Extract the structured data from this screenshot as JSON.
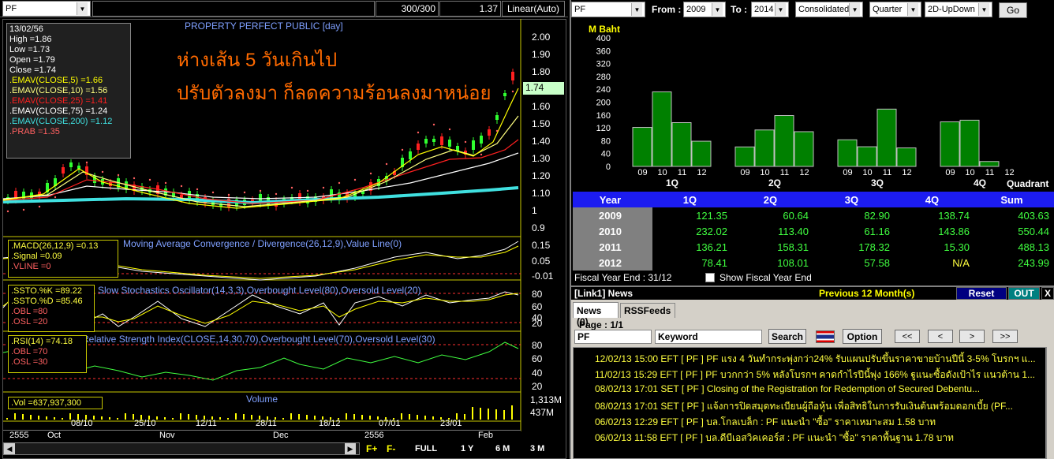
{
  "left": {
    "symbol": "PF",
    "range": "300/300",
    "last_value": "1.37",
    "scale": "Linear(Auto)",
    "main_title": "PROPERTY PERFECT PUBLIC [day]",
    "annotation_line1": "ห่างเส้น 5 วันเกินไป",
    "annotation_line2": "ปรับตัวลงมา ก็ลดความร้อนลงมาหน่อย",
    "price_tag": "1.74",
    "info": [
      "13/02/56",
      "High =1.86",
      "Low =1.73",
      "Open =1.79",
      "Close =1.74"
    ],
    "emas": [
      {
        "text": ".EMAV(CLOSE,5)  =1.66",
        "color": "#ffff00"
      },
      {
        "text": ".EMAV(CLOSE,10)  =1.56",
        "color": "#ffff80"
      },
      {
        "text": ".EMAV(CLOSE,25)  =1.41",
        "color": "#ff2020"
      },
      {
        "text": ".EMAV(CLOSE,75)  =1.24",
        "color": "#ffffff"
      },
      {
        "text": ".EMAV(CLOSE,200) =1.12",
        "color": "#40e0e0"
      },
      {
        "text": ".PRAB  =1.35",
        "color": "#ff6060"
      }
    ],
    "y_axis": [
      "2.00",
      "1.90",
      "1.80",
      "1.70",
      "1.60",
      "1.50",
      "1.40",
      "1.30",
      "1.20",
      "1.10",
      "1",
      "0.9"
    ],
    "macd": {
      "title": "Moving Average Convergence / Divergence(26,12,9),Value Line(0)",
      "lines": [
        ".MACD(26,12,9)  =0.13",
        ".Signal  =0.09",
        ".VLINE  =0"
      ],
      "axis": [
        "0.15",
        "0.05",
        "-0.01"
      ]
    },
    "stoch": {
      "title": "Slow Stochastics Oscillator(14,3,3),Overbought Level(80),Oversold Level(20)",
      "lines": [
        ".SSTO.%K  =89.22",
        ".SSTO.%D  =85.46",
        ".OBL  =80",
        ".OSL  =20"
      ],
      "axis": [
        "80",
        "60",
        "40",
        "20"
      ]
    },
    "rsi": {
      "title": "Relative Strength Index(CLOSE,14,30,70),Overbought Level(70),Oversold Level(30)",
      "lines": [
        ".RSI(14)  =74.18",
        ".OBL  =70",
        ".OSL  =30"
      ],
      "axis": [
        "80",
        "60",
        "40",
        "20"
      ]
    },
    "volume": {
      "title": "Volume",
      "line": ".Vol  =637,937,300",
      "axis": [
        "1,313M",
        "437M"
      ]
    },
    "x_axis_top": [
      "2555",
      "Oct",
      "Nov",
      "Dec",
      "2556",
      "Feb"
    ],
    "x_axis_dates": [
      "08/10",
      "25/10",
      "12/11",
      "28/11",
      "18/12",
      "07/01",
      "23/01"
    ],
    "periods": [
      "FULL",
      "1 Y",
      "6 M",
      "3 M"
    ],
    "fplus": "F+",
    "fminus": "F-"
  },
  "right": {
    "symbol": "PF",
    "from_label": "From :",
    "from_value": "2009",
    "to_label": "To :",
    "to_value": "2014",
    "consolidation": "Consolidated",
    "period": "Quarter",
    "chart_style": "2D-UpDown",
    "go": "Go",
    "unit_label": "M Baht",
    "quadrant_label": "Quadrant",
    "fiscal_label": "Fiscal  Year  End  :  31/12",
    "show_fiscal": "Show Fiscal Year End",
    "table": {
      "headers": [
        "Year",
        "1Q",
        "2Q",
        "3Q",
        "4Q",
        "Sum"
      ],
      "rows": [
        [
          "2009",
          "121.35",
          "60.64",
          "82.90",
          "138.74",
          "403.63"
        ],
        [
          "2010",
          "232.02",
          "113.40",
          "61.16",
          "143.86",
          "550.44"
        ],
        [
          "2011",
          "136.21",
          "158.31",
          "178.32",
          "15.30",
          "488.13"
        ],
        [
          "2012",
          "78.41",
          "108.01",
          "57.58",
          "N/A",
          "243.99"
        ]
      ]
    },
    "news_header": "[Link1] News",
    "news_prev": "Previous 12 Month(s)",
    "reset": "Reset",
    "out": "OUT",
    "close": "X",
    "tabs": [
      "News (0)",
      "RSSFeeds"
    ],
    "page": "Page :  1/1",
    "news_symbol": "PF",
    "keyword_placeholder": "Keyword",
    "search": "Search",
    "option": "Option",
    "nav": [
      "<<",
      "<",
      ">",
      ">>"
    ],
    "news": [
      "12/02/13 15:00  EFT  [ PF ]  PF แรง 4 วันทำกระพุ่งกว่า24% รับแผนปรับขึ้นราคาขายบ้านปีนี้ 3-5% โบรกฯ แ...",
      "11/02/13 15:29  EFT  [ PF ]  PF บวกกว่า 5% หลังโบรกฯ คาดกำไรปีนี้พุ่ง 166% ฐูแนะซื้อดังเป้าไร แนวต้าน 1...",
      "08/02/13 17:01  SET  [ PF ]  Closing of the Registration for Redemption of Secured Debentu...",
      "08/02/13 17:01  SET  [ PF ]  แจ้งการปิดสมุดทะเบียนผู้ถือหุ้น เพื่อสิทธิในการรับเงินต้นพร้อมดอกเบี้ย (PF...",
      "06/02/13 12:29  EFT  [ PF ]  บล.โกลเบล็ก : PF แนะนำ \"ซื้อ\" ราคาเหมาะสม 1.58 บาท",
      "06/02/13 11:58  EFT  [ PF ]  บล.ดีบีเอสวิคเคอร์ส : PF แนะนำ \"ซื้อ\" ราคาพื้นฐาน 1.78 บาท"
    ]
  },
  "chart_data": {
    "type": "bar",
    "ylabel": "M Baht",
    "ylim": [
      0,
      400
    ],
    "yticks": [
      0,
      40,
      80,
      120,
      160,
      200,
      240,
      280,
      320,
      360,
      400
    ],
    "groups": [
      {
        "name": "1Q",
        "categories": [
          "09",
          "10",
          "11",
          "12"
        ],
        "values": [
          121.35,
          232.02,
          136.21,
          78.41
        ]
      },
      {
        "name": "2Q",
        "categories": [
          "09",
          "10",
          "11",
          "12"
        ],
        "values": [
          60.64,
          113.4,
          158.31,
          108.01
        ]
      },
      {
        "name": "3Q",
        "categories": [
          "09",
          "10",
          "11",
          "12"
        ],
        "values": [
          82.9,
          61.16,
          178.32,
          57.58
        ]
      },
      {
        "name": "4Q",
        "categories": [
          "09",
          "10",
          "11",
          "12"
        ],
        "values": [
          138.74,
          143.86,
          15.3,
          0
        ]
      }
    ],
    "xlabel": "Quadrant"
  }
}
